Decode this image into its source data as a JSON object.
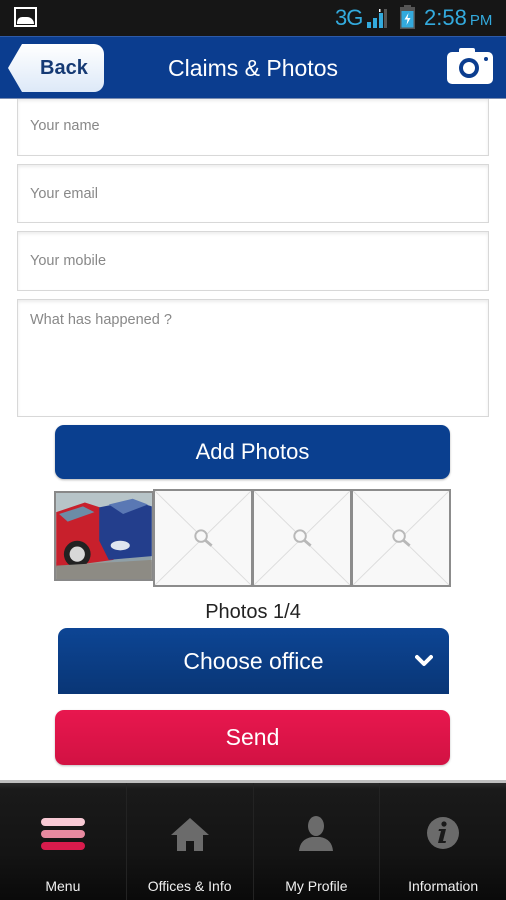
{
  "status_bar": {
    "network": "3G",
    "time": "2:58",
    "ampm": "PM",
    "accent_color": "#33aadd"
  },
  "header": {
    "back_label": "Back",
    "title": "Claims & Photos",
    "camera_icon": "camera-icon",
    "background_color": "#0b3d8f"
  },
  "form": {
    "name_placeholder": "Your name",
    "email_placeholder": "Your email",
    "mobile_placeholder": "Your mobile",
    "what_placeholder": "What has happened ?",
    "add_photos_label": "Add Photos",
    "photos": {
      "count_label": "Photos 1/4",
      "filled": 1,
      "total": 4,
      "slots": [
        {
          "state": "photo",
          "description": "car accident photo"
        },
        {
          "state": "empty",
          "icon": "magnifier-icon"
        },
        {
          "state": "empty",
          "icon": "magnifier-icon"
        },
        {
          "state": "empty",
          "icon": "magnifier-icon"
        }
      ]
    },
    "office_select_label": "Choose office",
    "send_label": "Send",
    "primary_color": "#0a3f8f",
    "send_color": "#e0144a"
  },
  "bottom_nav": {
    "items": [
      {
        "label": "Menu",
        "icon": "menu-icon",
        "active": true
      },
      {
        "label": "Offices & Info",
        "icon": "home-icon",
        "active": false
      },
      {
        "label": "My Profile",
        "icon": "profile-icon",
        "active": false
      },
      {
        "label": "Information",
        "icon": "info-icon",
        "active": false
      }
    ]
  }
}
